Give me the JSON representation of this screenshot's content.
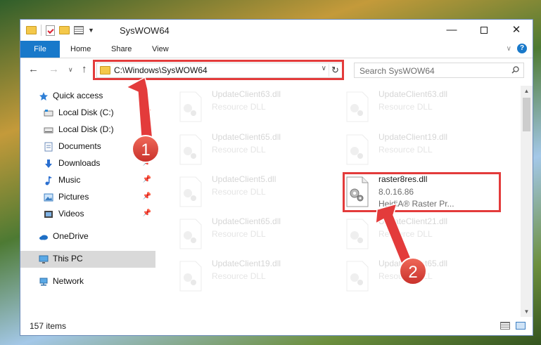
{
  "window": {
    "title": "SysWOW64",
    "minimize_glyph": "—",
    "close_glyph": "✕"
  },
  "ribbon": {
    "tabs": [
      "File",
      "Home",
      "Share",
      "View"
    ]
  },
  "navigation": {
    "back_glyph": "←",
    "forward_glyph": "→",
    "recent_glyph": "∨",
    "up_glyph": "↑",
    "address": "C:\\Windows\\SysWOW64",
    "search_placeholder": "Search SysWOW64"
  },
  "sidebar": {
    "items": [
      {
        "label": "Quick access",
        "icon": "star-icon",
        "pinned": false
      },
      {
        "label": "Local Disk (C:)",
        "icon": "drive-icon",
        "pinned": true
      },
      {
        "label": "Local Disk (D:)",
        "icon": "drive-icon",
        "pinned": true
      },
      {
        "label": "Documents",
        "icon": "documents-icon",
        "pinned": true
      },
      {
        "label": "Downloads",
        "icon": "downloads-icon",
        "pinned": true
      },
      {
        "label": "Music",
        "icon": "music-icon",
        "pinned": true
      },
      {
        "label": "Pictures",
        "icon": "pictures-icon",
        "pinned": true
      },
      {
        "label": "Videos",
        "icon": "videos-icon",
        "pinned": true
      },
      {
        "label": "OneDrive",
        "icon": "cloud-icon",
        "pinned": false
      },
      {
        "label": "This PC",
        "icon": "computer-icon",
        "pinned": false,
        "selected": true
      },
      {
        "label": "Network",
        "icon": "network-icon",
        "pinned": false
      }
    ]
  },
  "files": [
    {
      "name": "UpdateClient63.dll",
      "line2": "Resource DLL",
      "faded": true
    },
    {
      "name": "UpdateClient63.dll",
      "line2": "Resource DLL",
      "faded": true
    },
    {
      "name": "UpdateClient65.dll",
      "line2": "Resource DLL",
      "faded": true
    },
    {
      "name": "UpdateClient19.dll",
      "line2": "Resource DLL",
      "faded": true
    },
    {
      "name": "UpdateClient5.dll",
      "line2": "Resource DLL",
      "faded": true
    },
    {
      "name": "raster8res.dll",
      "line2": "8.0.16.86",
      "line3": "HeidiA® Raster Pr...",
      "faded": false
    },
    {
      "name": "UpdateClient65.dll",
      "line2": "Resource DLL",
      "faded": true
    },
    {
      "name": "UpdateClient21.dll",
      "line2": "Resource DLL",
      "faded": true
    },
    {
      "name": "UpdateClient19.dll",
      "line2": "Resource DLL",
      "faded": true
    },
    {
      "name": "UpdateClient65.dll",
      "line2": "Resource DLL",
      "faded": true
    }
  ],
  "status": {
    "item_count": "157 items"
  },
  "annotations": {
    "badge1": "1",
    "badge2": "2",
    "highlight_color": "#e33b3b"
  },
  "colors": {
    "accent": "#1979ca",
    "folder": "#f4c84a"
  }
}
